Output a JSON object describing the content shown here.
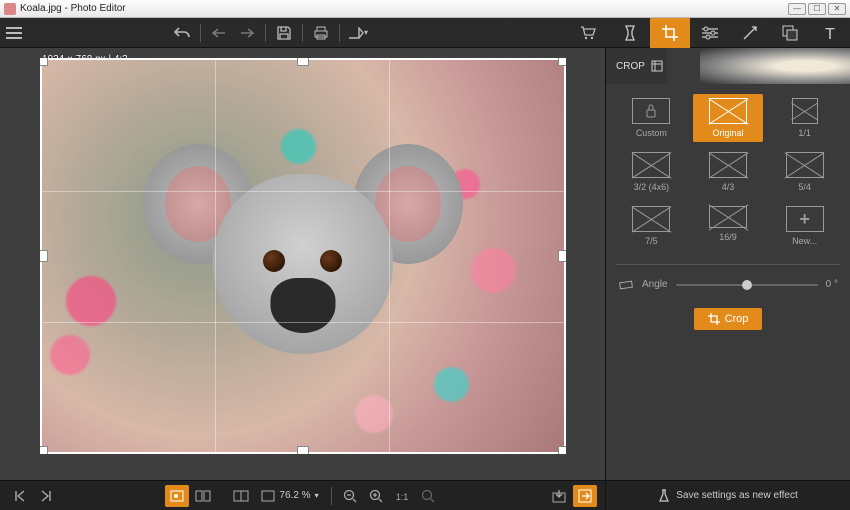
{
  "window": {
    "title": "Koala.jpg - Photo Editor"
  },
  "toolbar": {
    "undo": "↶",
    "back": "←",
    "fwd": "→"
  },
  "canvas": {
    "dim_label": "1024 × 768 px | 4:3"
  },
  "bottom": {
    "zoom": "76.2 %"
  },
  "panel": {
    "title": "CROP",
    "ratios": [
      {
        "label": "Custom"
      },
      {
        "label": "Original"
      },
      {
        "label": "1/1"
      },
      {
        "label": "3/2 (4x6)"
      },
      {
        "label": "4/3"
      },
      {
        "label": "5/4"
      },
      {
        "label": "7/5"
      },
      {
        "label": "16/9"
      },
      {
        "label": "New..."
      }
    ],
    "angle_label": "Angle",
    "angle_value": "0 °",
    "crop_btn": "Crop",
    "save_effect": "Save settings as new effect"
  }
}
